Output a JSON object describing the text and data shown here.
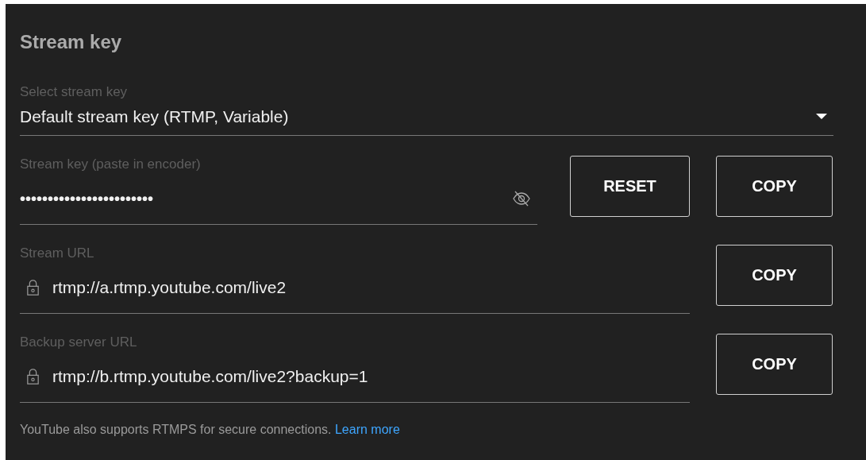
{
  "heading": "Stream key",
  "fields": [
    {
      "kind": "select",
      "label": "Select stream key",
      "value": "Default stream key (RTMP, Variable)"
    },
    {
      "kind": "secret",
      "label": "Stream key (paste in encoder)",
      "value": "••••••••••••••••••••••••",
      "buttons": [
        "RESET",
        "COPY"
      ]
    },
    {
      "kind": "url",
      "label": "Stream URL",
      "value": "rtmp://a.rtmp.youtube.com/live2",
      "buttons": [
        "COPY"
      ]
    },
    {
      "kind": "url",
      "label": "Backup server URL",
      "value": "rtmp://b.rtmp.youtube.com/live2?backup=1",
      "buttons": [
        "COPY"
      ]
    }
  ],
  "footer": {
    "text": "YouTube also supports RTMPS for secure connections.",
    "link": "Learn more"
  }
}
